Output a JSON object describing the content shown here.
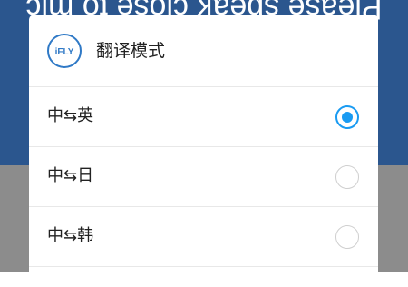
{
  "background": {
    "prompt_text": "Please speak close to mic"
  },
  "dialog": {
    "logo_text": "iFLY",
    "title": "翻译模式",
    "options": [
      {
        "label": "中⇆英",
        "selected": true
      },
      {
        "label": "中⇆日",
        "selected": false
      },
      {
        "label": "中⇆韩",
        "selected": false
      }
    ]
  },
  "colors": {
    "top_bg": "#2b568e",
    "bottom_bg": "#8c8c8c",
    "accent": "#1a9bf2",
    "logo": "#2f79c6"
  }
}
